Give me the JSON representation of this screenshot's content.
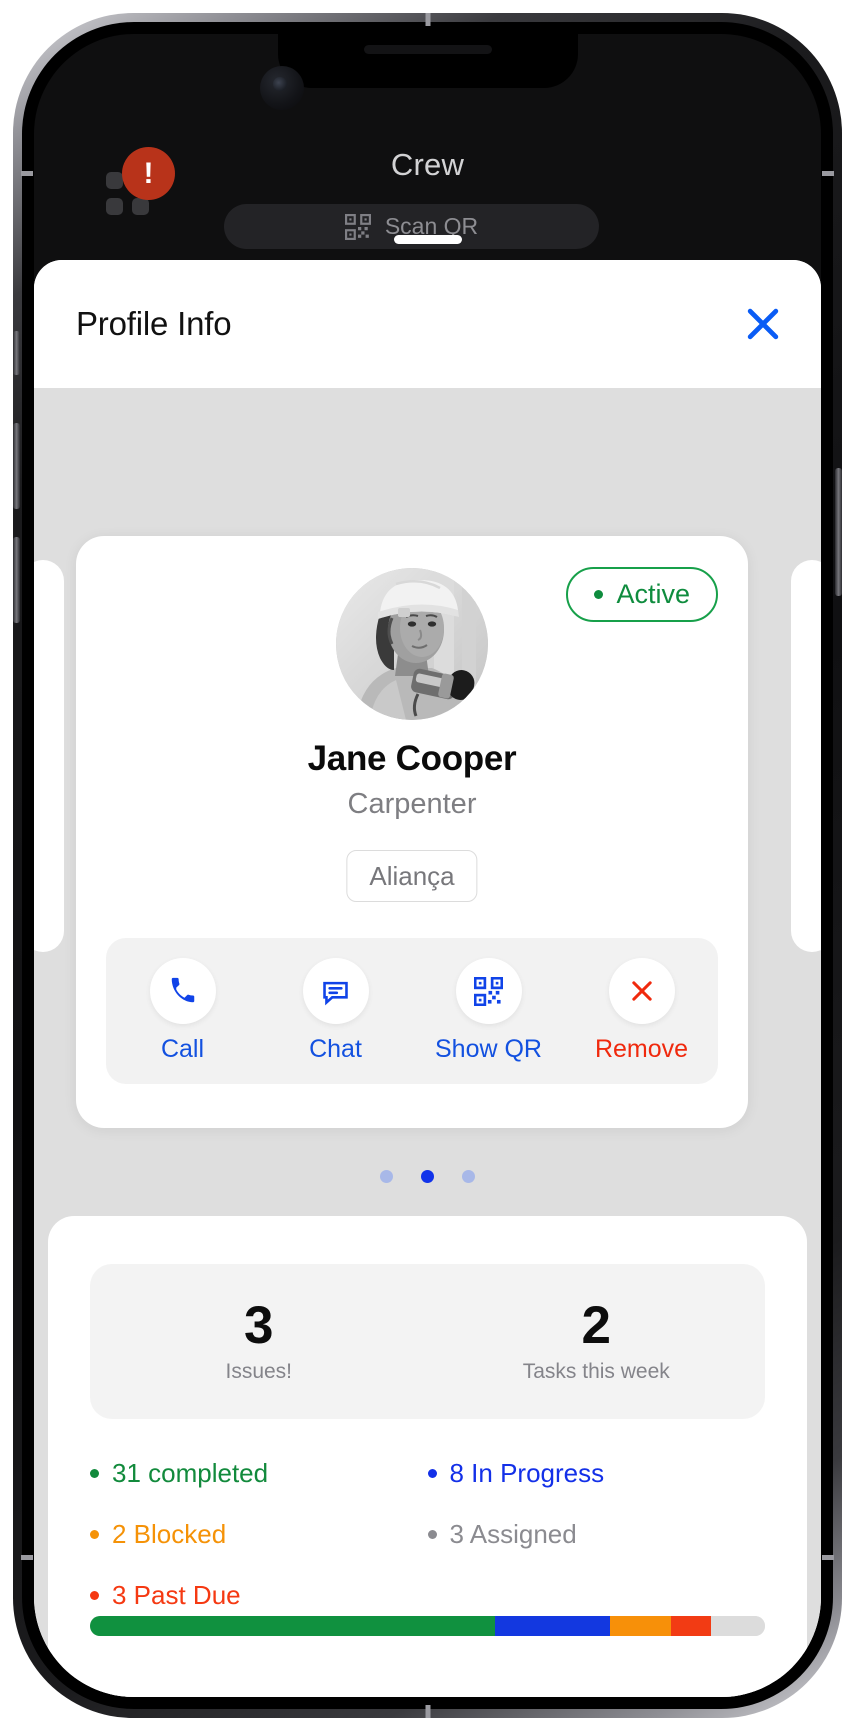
{
  "app": {
    "nav_title": "Crew",
    "alert_badge": "!",
    "scan_button_label": "Scan QR"
  },
  "sheet": {
    "title": "Profile Info",
    "close_label": "×"
  },
  "profile": {
    "status_badge": "Active",
    "name": "Jane Cooper",
    "role": "Carpenter",
    "company": "Aliança",
    "actions": [
      {
        "label": "Call",
        "icon": "phone-icon",
        "tone": "primary"
      },
      {
        "label": "Chat",
        "icon": "chat-icon",
        "tone": "primary"
      },
      {
        "label": "Show QR",
        "icon": "qr-icon",
        "tone": "primary"
      },
      {
        "label": "Remove",
        "icon": "close-icon",
        "tone": "danger"
      }
    ]
  },
  "carousel": {
    "total": 3,
    "active_index": 1
  },
  "stats": {
    "cards": [
      {
        "value": "3",
        "caption": "Issues!"
      },
      {
        "value": "2",
        "caption": "Tasks this week"
      }
    ],
    "legend": [
      {
        "label": "31 completed",
        "color": "#128a3c"
      },
      {
        "label": "8 In Progress",
        "color": "#1330e8"
      },
      {
        "label": "2 Blocked",
        "color": "#f59207"
      },
      {
        "label": "3 Assigned",
        "color": "#8b8b90"
      },
      {
        "label": "3 Past Due",
        "color": "#f53912"
      }
    ],
    "progress": [
      {
        "name": "completed",
        "color": "#10913f",
        "percent": 60
      },
      {
        "name": "in-progress",
        "color": "#1338e0",
        "percent": 17
      },
      {
        "name": "blocked",
        "color": "#f79009",
        "percent": 9
      },
      {
        "name": "past-due",
        "color": "#f23b14",
        "percent": 6
      },
      {
        "name": "remaining",
        "color": "#dcdcdc",
        "percent": 8
      }
    ]
  },
  "colors": {
    "accent_blue": "#1351e0",
    "danger_red": "#f0290d",
    "success_green": "#0f8c3e"
  }
}
